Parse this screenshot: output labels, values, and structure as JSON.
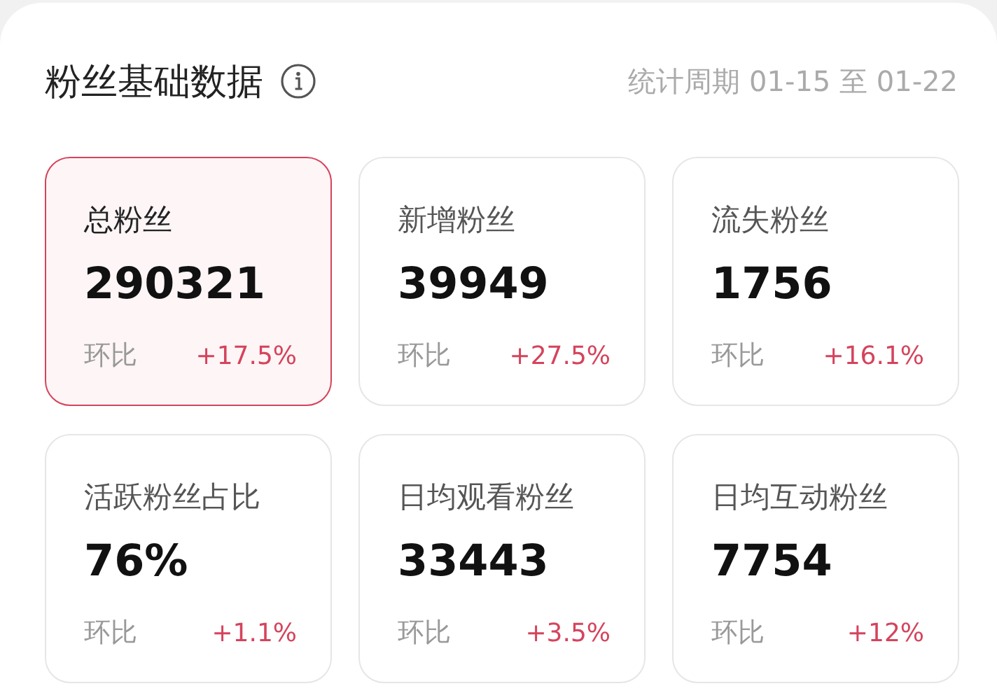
{
  "header": {
    "title": "粉丝基础数据",
    "period": "统计周期 01-15 至 01-22"
  },
  "metrics": [
    {
      "label": "总粉丝",
      "value": "290321",
      "compare_label": "环比",
      "change": "+17.5%",
      "selected": true
    },
    {
      "label": "新增粉丝",
      "value": "39949",
      "compare_label": "环比",
      "change": "+27.5%",
      "selected": false
    },
    {
      "label": "流失粉丝",
      "value": "1756",
      "compare_label": "环比",
      "change": "+16.1%",
      "selected": false
    },
    {
      "label": "活跃粉丝占比",
      "value": "76%",
      "compare_label": "环比",
      "change": "+1.1%",
      "selected": false
    },
    {
      "label": "日均观看粉丝",
      "value": "33443",
      "compare_label": "环比",
      "change": "+3.5%",
      "selected": false
    },
    {
      "label": "日均互动粉丝",
      "value": "7754",
      "compare_label": "环比",
      "change": "+12%",
      "selected": false
    }
  ]
}
